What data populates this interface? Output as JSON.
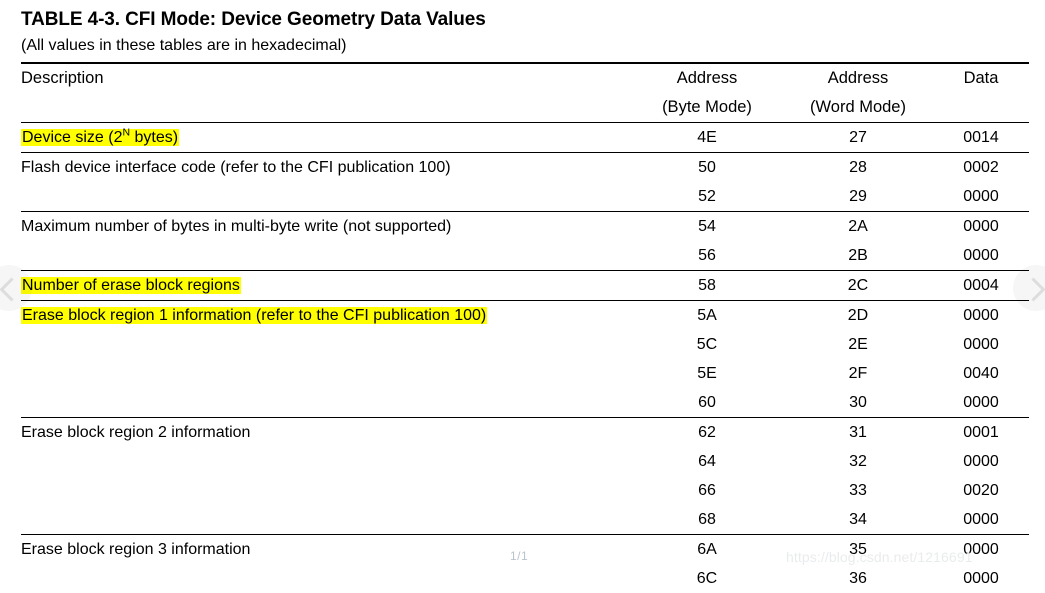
{
  "document": {
    "title": "TABLE 4-3. CFI Mode: Device Geometry Data Values",
    "subtitle": "(All values in these tables are in hexadecimal)"
  },
  "table": {
    "headers": {
      "description": "Description",
      "address_byte_line1": "Address",
      "address_byte_line2": "(Byte Mode)",
      "address_word_line1": "Address",
      "address_word_line2": "(Word Mode)",
      "data": "Data"
    },
    "rows": [
      {
        "description": "Device size (2",
        "description_sup": "N",
        "description_tail": " bytes)",
        "highlighted": true,
        "section_start": true,
        "address_byte": "4E",
        "address_word": "27",
        "data": "0014"
      },
      {
        "description": "Flash device interface code (refer to the CFI publication 100)",
        "highlighted": false,
        "section_start": true,
        "address_byte": "50",
        "address_word": "28",
        "data": "0002"
      },
      {
        "description": "",
        "highlighted": false,
        "section_start": false,
        "address_byte": "52",
        "address_word": "29",
        "data": "0000"
      },
      {
        "description": "Maximum number of bytes in multi-byte write (not supported)",
        "highlighted": false,
        "section_start": true,
        "address_byte": "54",
        "address_word": "2A",
        "data": "0000"
      },
      {
        "description": "",
        "highlighted": false,
        "section_start": false,
        "address_byte": "56",
        "address_word": "2B",
        "data": "0000"
      },
      {
        "description": "Number of erase block regions",
        "highlighted": true,
        "section_start": true,
        "address_byte": "58",
        "address_word": "2C",
        "data": "0004"
      },
      {
        "description": "Erase block region 1 information (refer to the CFI publication 100)",
        "highlighted": true,
        "section_start": true,
        "address_byte": "5A",
        "address_word": "2D",
        "data": "0000"
      },
      {
        "description": "",
        "highlighted": false,
        "section_start": false,
        "address_byte": "5C",
        "address_word": "2E",
        "data": "0000"
      },
      {
        "description": "",
        "highlighted": false,
        "section_start": false,
        "address_byte": "5E",
        "address_word": "2F",
        "data": "0040"
      },
      {
        "description": "",
        "highlighted": false,
        "section_start": false,
        "address_byte": "60",
        "address_word": "30",
        "data": "0000"
      },
      {
        "description": "Erase block region 2 information",
        "highlighted": false,
        "section_start": true,
        "address_byte": "62",
        "address_word": "31",
        "data": "0001"
      },
      {
        "description": "",
        "highlighted": false,
        "section_start": false,
        "address_byte": "64",
        "address_word": "32",
        "data": "0000"
      },
      {
        "description": "",
        "highlighted": false,
        "section_start": false,
        "address_byte": "66",
        "address_word": "33",
        "data": "0020"
      },
      {
        "description": "",
        "highlighted": false,
        "section_start": false,
        "address_byte": "68",
        "address_word": "34",
        "data": "0000"
      },
      {
        "description": "Erase block region 3 information",
        "highlighted": false,
        "section_start": true,
        "address_byte": "6A",
        "address_word": "35",
        "data": "0000"
      },
      {
        "description": "",
        "highlighted": false,
        "section_start": false,
        "address_byte": "6C",
        "address_word": "36",
        "data": "0000"
      }
    ]
  },
  "viewer": {
    "page_indicator": "1/1",
    "watermark": "https://blog.csdn.net/1216691",
    "prev_arrow": "‹",
    "next_arrow": "›"
  },
  "colors": {
    "highlight": "#ffff00",
    "text": "#000000",
    "rule": "#000000"
  }
}
